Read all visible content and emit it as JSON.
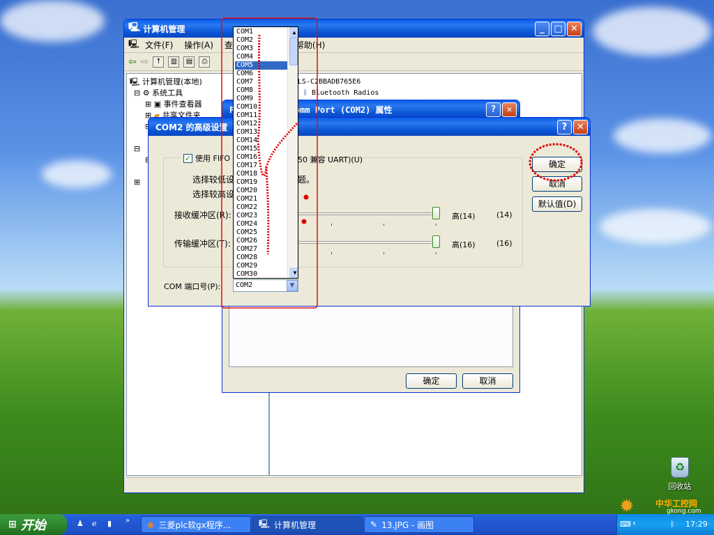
{
  "desktop": {
    "recycle_bin": "回收站",
    "watermark": "中华工控网",
    "watermark_url": "gkong.com"
  },
  "compmgmt": {
    "title": "计算机管理",
    "menu": [
      "文件(F)",
      "操作(A)",
      "查",
      "帮助(H)"
    ],
    "tree": [
      {
        "label": "计算机管理(本地)"
      },
      {
        "label": "系统工具"
      },
      {
        "label": "事件查看器"
      },
      {
        "label": "共享文件夹"
      }
    ],
    "right_header": "LS-C2BBADB765E6",
    "right_item": "Bluetooth Radios"
  },
  "props": {
    "title": "P         to-Serial Comm Port (COM2) 属性",
    "ok": "确定",
    "cancel": "取消"
  },
  "adv": {
    "title": "COM2 的高级设置",
    "fifo_label": "使用 FIFO",
    "fifo_suffix": "50 兼容 UART)(U)",
    "low_label": "选择较低设",
    "low_suffix": "题。",
    "high_label": "选择较高设",
    "recv_label": "接收缓冲区(R):",
    "recv_value_label": "高(14)",
    "recv_value": "(14)",
    "send_label": "传输缓冲区(T):",
    "send_value_label": "高(16)",
    "send_value": "(16)",
    "port_label": "COM 端口号(P):",
    "port_value": "COM2",
    "ok": "确定",
    "cancel": "取消",
    "default": "默认值(D)",
    "recv_level": 1.0,
    "send_level": 1.0
  },
  "dropdown": {
    "items": [
      "COM1",
      "COM2",
      "COM3",
      "COM4",
      "COM5",
      "COM6",
      "COM7",
      "COM8",
      "COM9",
      "COM10",
      "COM11",
      "COM12",
      "COM13",
      "COM14",
      "COM15",
      "COM16",
      "COM17",
      "COM18",
      "COM19",
      "COM20",
      "COM21",
      "COM22",
      "COM23",
      "COM24",
      "COM25",
      "COM26",
      "COM27",
      "COM28",
      "COM29",
      "COM30"
    ],
    "selected": "COM5"
  },
  "taskbar": {
    "start": "开始",
    "tasks": [
      {
        "label": "三菱plc软gx程序..."
      },
      {
        "label": "计算机管理"
      },
      {
        "label": "13.JPG - 画图"
      }
    ],
    "clock": "17:29"
  },
  "colors": {
    "xp_blue": "#0a5fe8",
    "annotation_red": "#e00000",
    "highlight": "#316ac5"
  }
}
